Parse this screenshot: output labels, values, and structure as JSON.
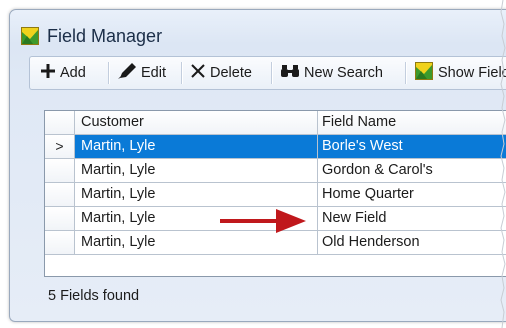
{
  "window": {
    "title": "Field Manager"
  },
  "toolbar": {
    "add_label": "Add",
    "edit_label": "Edit",
    "delete_label": "Delete",
    "new_search_label": "New Search",
    "show_fields_label": "Show Field"
  },
  "grid": {
    "columns": [
      "Customer",
      "Field Name"
    ],
    "selected_marker": ">",
    "rows": [
      {
        "customer": "Martin, Lyle",
        "field_name": "Borle's West",
        "selected": true
      },
      {
        "customer": "Martin, Lyle",
        "field_name": "Gordon & Carol's",
        "selected": false
      },
      {
        "customer": "Martin, Lyle",
        "field_name": "Home Quarter",
        "selected": false
      },
      {
        "customer": "Martin, Lyle",
        "field_name": "New Field",
        "selected": false
      },
      {
        "customer": "Martin, Lyle",
        "field_name": "Old Henderson",
        "selected": false
      }
    ]
  },
  "status": {
    "text": "5 Fields found"
  },
  "colors": {
    "selection": "#0a7ad7",
    "arrow": "#c0181c"
  },
  "icons": [
    "field-manager-icon",
    "plus-icon",
    "pencil-icon",
    "x-icon",
    "binoculars-icon",
    "show-fields-icon",
    "sort-indicator-icon",
    "red-arrow-icon"
  ]
}
